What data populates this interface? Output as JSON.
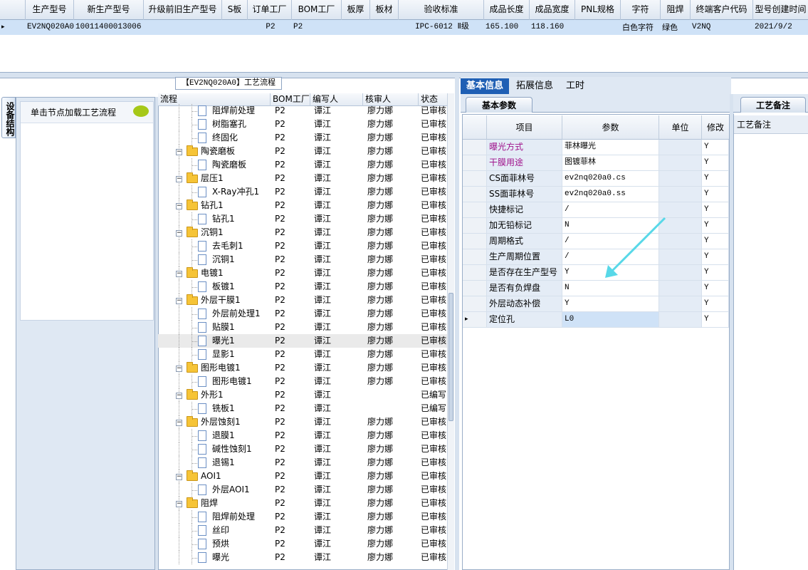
{
  "top_grid": {
    "columns": [
      "生产型号",
      "新生产型号",
      "升级前旧生产型号",
      "S板",
      "订单工厂",
      "BOM工厂",
      "板厚",
      "板材",
      "验收标准",
      "成品长度",
      "成品宽度",
      "PNL规格",
      "字符",
      "阻焊",
      "终端客户代码",
      "型号创建时间"
    ],
    "row": {
      "marker": "▸",
      "cells": [
        "EV2NQ020A0",
        "10011400013006",
        "",
        "",
        "P2",
        "P2",
        "",
        "",
        "IPC-6012 Ⅱ级",
        "165.100",
        "118.160",
        "",
        "白色字符",
        "绿色",
        "V2NQ",
        "2021/9/2"
      ]
    }
  },
  "left_panel": {
    "side_tab": "设备结构",
    "hint": "单击节点加载工艺流程"
  },
  "process": {
    "title": "【EV2NQ020A0】工艺流程",
    "columns": [
      "流程",
      "BOM工厂",
      "编写人",
      "核审人",
      "状态"
    ],
    "rows": [
      {
        "level": 2,
        "type": "doc",
        "name": "阻焊前处理",
        "bom": "P2",
        "writer": "谭江",
        "reviewer": "廖力娜",
        "status": "已审核"
      },
      {
        "level": 2,
        "type": "doc",
        "name": "树脂塞孔",
        "bom": "P2",
        "writer": "谭江",
        "reviewer": "廖力娜",
        "status": "已审核"
      },
      {
        "level": 2,
        "type": "doc",
        "name": "终固化",
        "bom": "P2",
        "writer": "谭江",
        "reviewer": "廖力娜",
        "status": "已审核"
      },
      {
        "level": 1,
        "type": "folder",
        "name": "陶瓷磨板",
        "bom": "P2",
        "writer": "谭江",
        "reviewer": "廖力娜",
        "status": "已审核"
      },
      {
        "level": 2,
        "type": "doc",
        "name": "陶瓷磨板",
        "bom": "P2",
        "writer": "谭江",
        "reviewer": "廖力娜",
        "status": "已审核"
      },
      {
        "level": 1,
        "type": "folder",
        "name": "层压1",
        "bom": "P2",
        "writer": "谭江",
        "reviewer": "廖力娜",
        "status": "已审核"
      },
      {
        "level": 2,
        "type": "doc",
        "name": "X-Ray冲孔1",
        "bom": "P2",
        "writer": "谭江",
        "reviewer": "廖力娜",
        "status": "已审核"
      },
      {
        "level": 1,
        "type": "folder",
        "name": "钻孔1",
        "bom": "P2",
        "writer": "谭江",
        "reviewer": "廖力娜",
        "status": "已审核"
      },
      {
        "level": 2,
        "type": "doc",
        "name": "钻孔1",
        "bom": "P2",
        "writer": "谭江",
        "reviewer": "廖力娜",
        "status": "已审核"
      },
      {
        "level": 1,
        "type": "folder",
        "name": "沉铜1",
        "bom": "P2",
        "writer": "谭江",
        "reviewer": "廖力娜",
        "status": "已审核"
      },
      {
        "level": 2,
        "type": "doc",
        "name": "去毛刺1",
        "bom": "P2",
        "writer": "谭江",
        "reviewer": "廖力娜",
        "status": "已审核"
      },
      {
        "level": 2,
        "type": "doc",
        "name": "沉铜1",
        "bom": "P2",
        "writer": "谭江",
        "reviewer": "廖力娜",
        "status": "已审核"
      },
      {
        "level": 1,
        "type": "folder",
        "name": "电镀1",
        "bom": "P2",
        "writer": "谭江",
        "reviewer": "廖力娜",
        "status": "已审核"
      },
      {
        "level": 2,
        "type": "doc",
        "name": "板镀1",
        "bom": "P2",
        "writer": "谭江",
        "reviewer": "廖力娜",
        "status": "已审核"
      },
      {
        "level": 1,
        "type": "folder",
        "name": "外层干膜1",
        "bom": "P2",
        "writer": "谭江",
        "reviewer": "廖力娜",
        "status": "已审核"
      },
      {
        "level": 2,
        "type": "doc",
        "name": "外层前处理1",
        "bom": "P2",
        "writer": "谭江",
        "reviewer": "廖力娜",
        "status": "已审核"
      },
      {
        "level": 2,
        "type": "doc",
        "name": "贴膜1",
        "bom": "P2",
        "writer": "谭江",
        "reviewer": "廖力娜",
        "status": "已审核"
      },
      {
        "level": 2,
        "type": "doc",
        "name": "曝光1",
        "bom": "P2",
        "writer": "谭江",
        "reviewer": "廖力娜",
        "status": "已审核",
        "selected": true
      },
      {
        "level": 2,
        "type": "doc",
        "name": "显影1",
        "bom": "P2",
        "writer": "谭江",
        "reviewer": "廖力娜",
        "status": "已审核"
      },
      {
        "level": 1,
        "type": "folder",
        "name": "图形电镀1",
        "bom": "P2",
        "writer": "谭江",
        "reviewer": "廖力娜",
        "status": "已审核"
      },
      {
        "level": 2,
        "type": "doc",
        "name": "图形电镀1",
        "bom": "P2",
        "writer": "谭江",
        "reviewer": "廖力娜",
        "status": "已审核"
      },
      {
        "level": 1,
        "type": "folder",
        "name": "外形1",
        "bom": "P2",
        "writer": "谭江",
        "reviewer": "",
        "status": "已编写"
      },
      {
        "level": 2,
        "type": "doc",
        "name": "铣板1",
        "bom": "P2",
        "writer": "谭江",
        "reviewer": "",
        "status": "已编写"
      },
      {
        "level": 1,
        "type": "folder",
        "name": "外层蚀刻1",
        "bom": "P2",
        "writer": "谭江",
        "reviewer": "廖力娜",
        "status": "已审核"
      },
      {
        "level": 2,
        "type": "doc",
        "name": "退膜1",
        "bom": "P2",
        "writer": "谭江",
        "reviewer": "廖力娜",
        "status": "已审核"
      },
      {
        "level": 2,
        "type": "doc",
        "name": "碱性蚀刻1",
        "bom": "P2",
        "writer": "谭江",
        "reviewer": "廖力娜",
        "status": "已审核"
      },
      {
        "level": 2,
        "type": "doc",
        "name": "退锡1",
        "bom": "P2",
        "writer": "谭江",
        "reviewer": "廖力娜",
        "status": "已审核"
      },
      {
        "level": 1,
        "type": "folder",
        "name": "AOI1",
        "bom": "P2",
        "writer": "谭江",
        "reviewer": "廖力娜",
        "status": "已审核"
      },
      {
        "level": 2,
        "type": "doc",
        "name": "外层AOI1",
        "bom": "P2",
        "writer": "谭江",
        "reviewer": "廖力娜",
        "status": "已审核"
      },
      {
        "level": 1,
        "type": "folder",
        "name": "阻焊",
        "bom": "P2",
        "writer": "谭江",
        "reviewer": "廖力娜",
        "status": "已审核"
      },
      {
        "level": 2,
        "type": "doc",
        "name": "阻焊前处理",
        "bom": "P2",
        "writer": "谭江",
        "reviewer": "廖力娜",
        "status": "已审核"
      },
      {
        "level": 2,
        "type": "doc",
        "name": "丝印",
        "bom": "P2",
        "writer": "谭江",
        "reviewer": "廖力娜",
        "status": "已审核"
      },
      {
        "level": 2,
        "type": "doc",
        "name": "预烘",
        "bom": "P2",
        "writer": "谭江",
        "reviewer": "廖力娜",
        "status": "已审核"
      },
      {
        "level": 2,
        "type": "doc",
        "name": "曝光",
        "bom": "P2",
        "writer": "谭江",
        "reviewer": "廖力娜",
        "status": "已审核"
      }
    ]
  },
  "right_tabs": [
    "基本信息",
    "拓展信息",
    "工时"
  ],
  "params": {
    "tab": "基本参数",
    "columns": [
      "项目",
      "参数",
      "单位",
      "修改"
    ],
    "rows": [
      {
        "item": "曝光方式",
        "value": "菲林曝光",
        "unit": "",
        "mod": "Y",
        "highlight": true
      },
      {
        "item": "干膜用途",
        "value": "图镀菲林",
        "unit": "",
        "mod": "Y",
        "highlight": true
      },
      {
        "item": "CS面菲林号",
        "value": "ev2nq020a0.cs",
        "unit": "",
        "mod": "Y"
      },
      {
        "item": "SS面菲林号",
        "value": "ev2nq020a0.ss",
        "unit": "",
        "mod": "Y"
      },
      {
        "item": "快捷标记",
        "value": "/",
        "unit": "",
        "mod": "Y"
      },
      {
        "item": "加无铅标记",
        "value": "N",
        "unit": "",
        "mod": "Y"
      },
      {
        "item": "周期格式",
        "value": "/",
        "unit": "",
        "mod": "Y"
      },
      {
        "item": "生产周期位置",
        "value": "/",
        "unit": "",
        "mod": "Y"
      },
      {
        "item": "是否存在生产型号",
        "value": "Y",
        "unit": "",
        "mod": "Y"
      },
      {
        "item": "是否有负焊盘",
        "value": "N",
        "unit": "",
        "mod": "Y"
      },
      {
        "item": "外层动态补偿",
        "value": "Y",
        "unit": "",
        "mod": "Y"
      },
      {
        "item": "定位孔",
        "value": "L0",
        "unit": "",
        "mod": "Y",
        "current": true
      }
    ]
  },
  "notes": {
    "tab": "工艺备注",
    "header": "工艺备注"
  },
  "colors": {
    "highlight_text": "#a0148c",
    "selection": "#cfe2f7",
    "arrow": "#58d8e8"
  }
}
